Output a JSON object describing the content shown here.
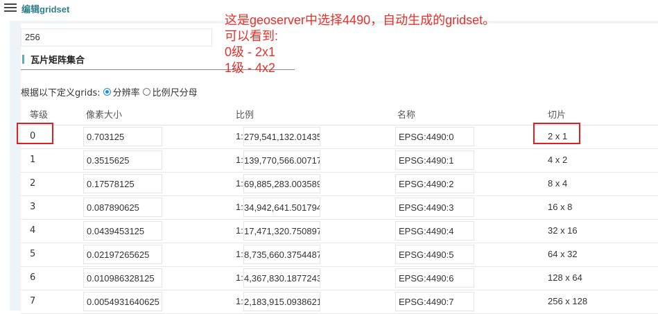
{
  "header": {
    "title": "编辑gridset"
  },
  "tile_size": {
    "value": "256"
  },
  "section": {
    "title": "瓦片矩阵集合"
  },
  "define": {
    "label": "根据以下定义grids:",
    "option_resolution": "分辨率",
    "option_scale": "比例尺分母",
    "selected": "分辨率"
  },
  "table": {
    "headers": {
      "level": "等级",
      "pixel_size": "像素大小",
      "scale": "比例",
      "name": "名称",
      "tiles": "切片"
    },
    "scale_prefix": "1:",
    "rows": [
      {
        "level": "0",
        "pixel_size": "0.703125",
        "scale": "279,541,132.01435",
        "name": "EPSG:4490:0",
        "tiles": "2 x 1"
      },
      {
        "level": "1",
        "pixel_size": "0.3515625",
        "scale": "139,770,566.00717",
        "name": "EPSG:4490:1",
        "tiles": "4 x 2"
      },
      {
        "level": "2",
        "pixel_size": "0.17578125",
        "scale": "69,885,283.003589",
        "name": "EPSG:4490:2",
        "tiles": "8 x 4"
      },
      {
        "level": "3",
        "pixel_size": "0.087890625",
        "scale": "34,942,641.501794",
        "name": "EPSG:4490:3",
        "tiles": "16 x 8"
      },
      {
        "level": "4",
        "pixel_size": "0.0439453125",
        "scale": "17,471,320.750897",
        "name": "EPSG:4490:4",
        "tiles": "32 x 16"
      },
      {
        "level": "5",
        "pixel_size": "0.02197265625",
        "scale": "8,735,660.3754487",
        "name": "EPSG:4490:5",
        "tiles": "64 x 32"
      },
      {
        "level": "6",
        "pixel_size": "0.010986328125",
        "scale": "4,367,830.1877243",
        "name": "EPSG:4490:6",
        "tiles": "128 x 64"
      },
      {
        "level": "7",
        "pixel_size": "0.0054931640625",
        "scale": "2,183,915.0938621",
        "name": "EPSG:4490:7",
        "tiles": "256 x 128"
      }
    ]
  },
  "annotation": {
    "lines": [
      "这是geoserver中选择4490，自动生成的gridset。",
      "可以看到:",
      "0级 - 2x1",
      "1级 - 4x2"
    ],
    "color": "#e8302a"
  },
  "colors": {
    "accent": "#2f7f8c",
    "highlight": "#e02020",
    "panel_bg": "#eef3f7"
  }
}
